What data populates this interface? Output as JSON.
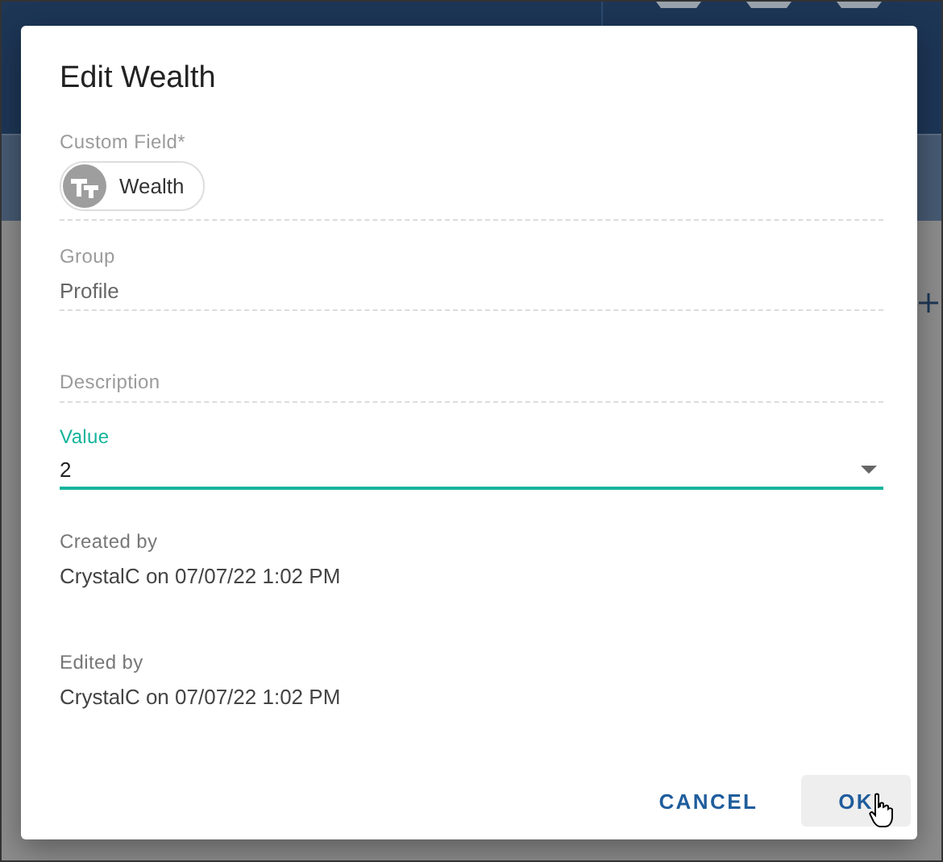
{
  "dialog": {
    "title": "Edit Wealth",
    "fields": [
      {
        "kind": "chip",
        "label": "Custom Field*",
        "value": "Wealth"
      },
      {
        "kind": "text",
        "label": "Group",
        "value": "Profile"
      },
      {
        "kind": "text",
        "label": "Description"
      },
      {
        "kind": "select",
        "label": "Value",
        "value": "2",
        "focused": true
      },
      {
        "kind": "info",
        "label": "Created by",
        "value": "CrystalC on 07/07/22 1:02 PM"
      },
      {
        "kind": "info",
        "label": "Edited by",
        "value": "CrystalC on 07/07/22 1:02 PM"
      }
    ],
    "buttons": [
      {
        "label": "CANCEL",
        "hovered": false
      },
      {
        "label": "OK",
        "hovered": true
      }
    ]
  }
}
